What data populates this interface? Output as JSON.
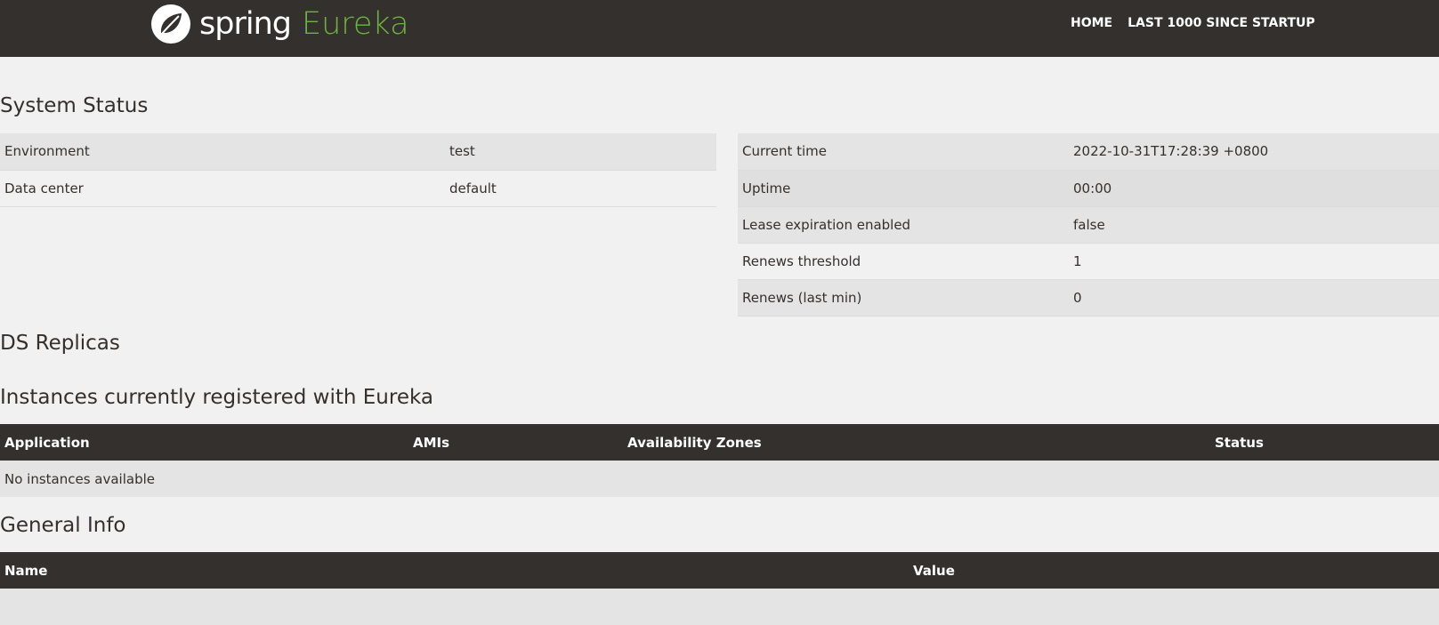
{
  "brand": {
    "spring": "spring",
    "eureka": "Eureka"
  },
  "nav": {
    "home": "HOME",
    "last1000": "LAST 1000 SINCE STARTUP"
  },
  "sections": {
    "system_status": "System Status",
    "ds_replicas": "DS Replicas",
    "instances": "Instances currently registered with Eureka",
    "general_info": "General Info"
  },
  "system_left": [
    {
      "label": "Environment",
      "value": "test"
    },
    {
      "label": "Data center",
      "value": "default"
    }
  ],
  "system_right": [
    {
      "label": "Current time",
      "value": "2022-10-31T17:28:39 +0800"
    },
    {
      "label": "Uptime",
      "value": "00:00"
    },
    {
      "label": "Lease expiration enabled",
      "value": "false"
    },
    {
      "label": "Renews threshold",
      "value": "1"
    },
    {
      "label": "Renews (last min)",
      "value": "0"
    }
  ],
  "instances_table": {
    "headers": [
      "Application",
      "AMIs",
      "Availability Zones",
      "Status"
    ],
    "empty": "No instances available"
  },
  "general_table": {
    "headers": [
      "Name",
      "Value"
    ]
  },
  "colors": {
    "navbar": "#34302d",
    "accent": "#6db33f",
    "background": "#f1f1f1"
  }
}
